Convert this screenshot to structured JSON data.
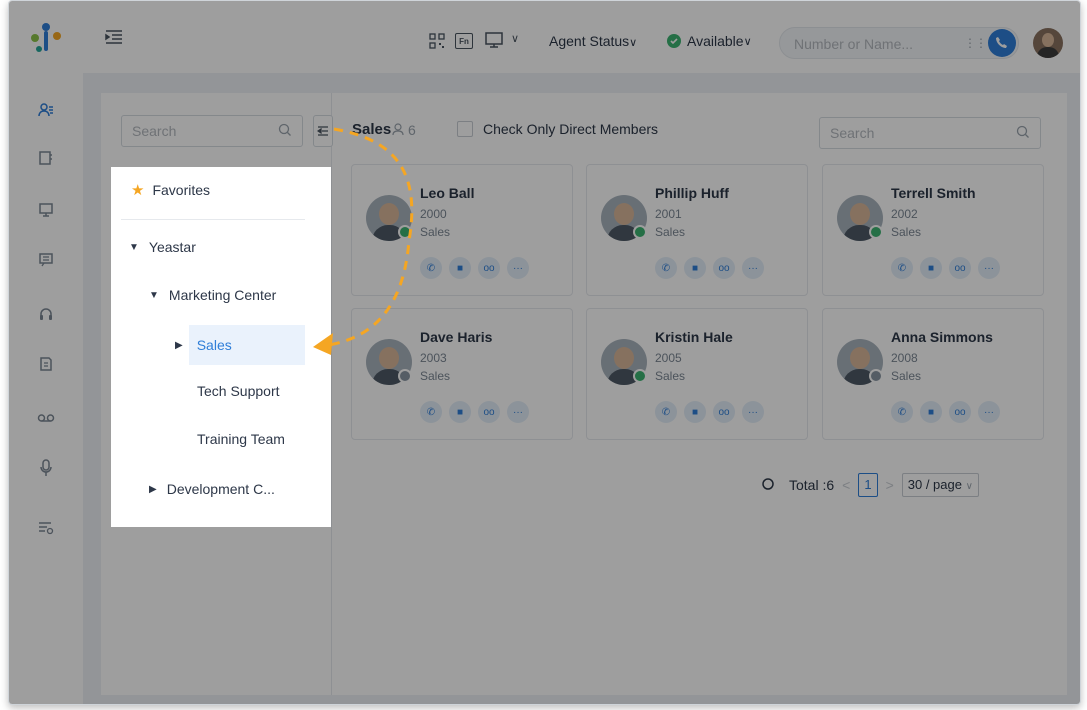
{
  "topbar": {
    "menu_icon": "menu-fold-icon",
    "qr_icon": "qrcode-icon",
    "fn_label": "Fn",
    "desktop_icon": "desktop-icon",
    "agent_status": "Agent Status",
    "available": "Available",
    "dial_placeholder": "Number or Name...",
    "keypad_icon": "keypad-icon",
    "call_icon": "phone-icon"
  },
  "sidebar": {
    "icons": [
      "contacts-icon",
      "extension-icon",
      "monitor-icon",
      "chat-icon",
      "headset-icon",
      "report-icon",
      "voicemail-icon",
      "microphone-icon",
      "settings-list-icon"
    ]
  },
  "left_search": {
    "placeholder": "Search"
  },
  "tree": {
    "favorites": "Favorites",
    "items": [
      {
        "label": "Yeastar",
        "expanded": true
      },
      {
        "label": "Marketing Center",
        "expanded": true
      },
      {
        "label": "Sales",
        "selected": true
      },
      {
        "label": "Tech Support"
      },
      {
        "label": "Training Team"
      },
      {
        "label": "Development C...",
        "expanded": false
      }
    ]
  },
  "group": {
    "title": "Sales",
    "count": "6",
    "direct_members_label": "Check Only Direct Members",
    "search_placeholder": "Search"
  },
  "members": [
    {
      "name": "Leo Ball",
      "ext": "2000",
      "dept": "Sales",
      "status": "available",
      "status_color": "#3cb371"
    },
    {
      "name": "Phillip Huff",
      "ext": "2001",
      "dept": "Sales",
      "status": "available",
      "status_color": "#3cb371"
    },
    {
      "name": "Terrell Smith",
      "ext": "2002",
      "dept": "Sales",
      "status": "available",
      "status_color": "#3cb371"
    },
    {
      "name": "Dave Haris",
      "ext": "2003",
      "dept": "Sales",
      "status": "offline",
      "status_color": "#8a96a3"
    },
    {
      "name": "Kristin Hale",
      "ext": "2005",
      "dept": "Sales",
      "status": "available",
      "status_color": "#3cb371"
    },
    {
      "name": "Anna Simmons",
      "ext": "2008",
      "dept": "Sales",
      "status": "offline",
      "status_color": "#8a96a3"
    }
  ],
  "pagination": {
    "total_label": "Total :6",
    "page": "1",
    "page_size": "30 / page"
  },
  "colors": {
    "accent": "#2f7ed8",
    "arrow": "#f5a623",
    "star": "#f5a623"
  }
}
